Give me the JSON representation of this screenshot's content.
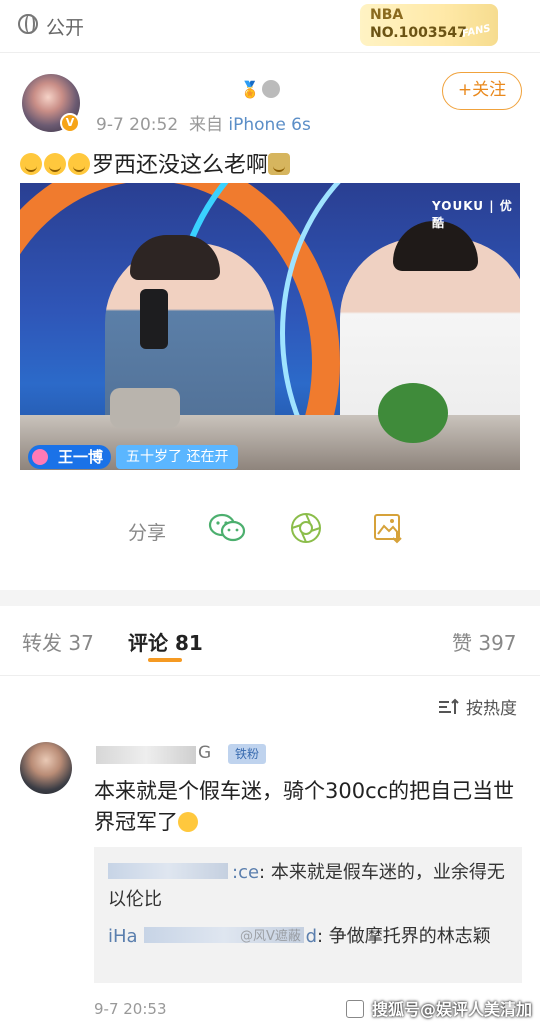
{
  "header": {
    "visibility": "公开",
    "badge": {
      "league": "NBA",
      "number": "NO.1003547",
      "suffix": "FANS"
    }
  },
  "post": {
    "meta": {
      "time": "9-7 20:52",
      "from_label": "来自",
      "device": "iPhone 6s"
    },
    "follow_label": "+关注",
    "text": "罗西还没这么老啊",
    "video": {
      "watermark": "YOUKU | 优酷",
      "name_tag": "王一博",
      "subtitle": "五十岁了 还在开"
    },
    "share": {
      "label": "分享"
    }
  },
  "tabs": [
    {
      "label": "转发 37"
    },
    {
      "label": "评论 81"
    },
    {
      "label": "赞 397"
    }
  ],
  "sort_label": "按热度",
  "comment": {
    "name_visible": "G",
    "fan_badge": "铁粉",
    "text": "本来就是个假车迷，骑个300cc的把自己当世界冠军了",
    "replies": [
      {
        "user_suffix": ":ce",
        "text": ": 本来就是假车迷的，业余得无以伦比"
      },
      {
        "user_prefix": "iHa",
        "user_suffix": "d",
        "text": ": 争做摩托界的林志颖"
      }
    ],
    "time": "9-7 20:53"
  },
  "overlays": {
    "middle_watermark": "@风V遮蔽",
    "corner_watermark": "搜狐号@娱评人美清加"
  },
  "colors": {
    "accent": "#f59a23",
    "link": "#5b8ec7",
    "video_bg": "#2f56b8"
  }
}
